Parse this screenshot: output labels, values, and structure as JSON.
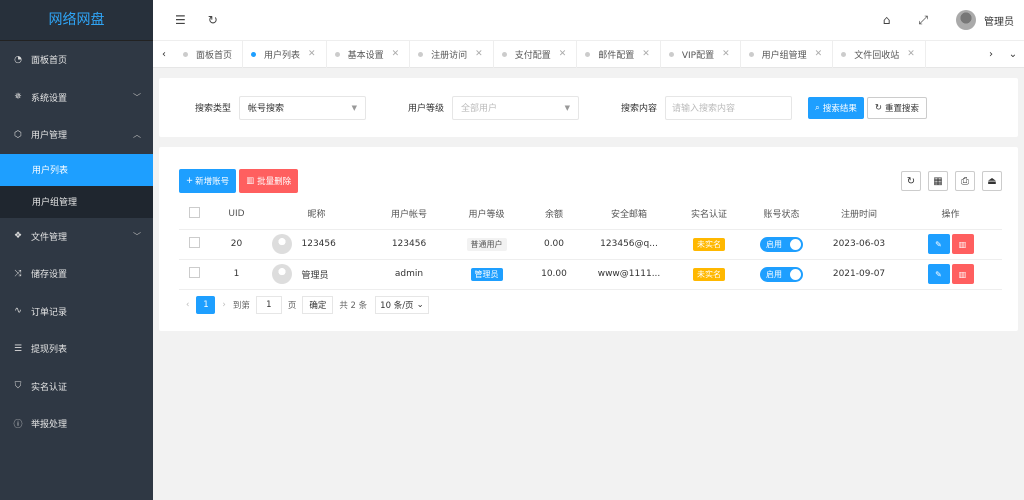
{
  "app": {
    "logo": "网络网盘"
  },
  "sidebar": {
    "items": [
      {
        "label": "面板首页",
        "icon": "dashboard-icon"
      },
      {
        "label": "系统设置",
        "icon": "gear-icon"
      },
      {
        "label": "用户管理",
        "icon": "cube-icon"
      },
      {
        "label": "文件管理",
        "icon": "layers-icon"
      },
      {
        "label": "储存设置",
        "icon": "shuffle-icon"
      },
      {
        "label": "订单记录",
        "icon": "pulse-icon"
      },
      {
        "label": "提现列表",
        "icon": "list-icon"
      },
      {
        "label": "实名认证",
        "icon": "shield-icon"
      },
      {
        "label": "举报处理",
        "icon": "alert-icon"
      }
    ],
    "sub_items": [
      {
        "label": "用户列表"
      },
      {
        "label": "用户组管理"
      }
    ]
  },
  "topbar": {
    "admin_name": "管理员"
  },
  "tabs": [
    {
      "label": "面板首页"
    },
    {
      "label": "用户列表"
    },
    {
      "label": "基本设置"
    },
    {
      "label": "注册访问"
    },
    {
      "label": "支付配置"
    },
    {
      "label": "邮件配置"
    },
    {
      "label": "VIP配置"
    },
    {
      "label": "用户组管理"
    },
    {
      "label": "文件回收站"
    }
  ],
  "search": {
    "type_label": "搜索类型",
    "type_value": "帐号搜索",
    "level_label": "用户等级",
    "level_value": "全部用户",
    "content_label": "搜索内容",
    "content_placeholder": "请输入搜索内容",
    "search_btn": "搜索结果",
    "reset_btn": "重置搜索"
  },
  "toolbar": {
    "add_btn": "新增账号",
    "delete_btn": "批量删除"
  },
  "table": {
    "headers": [
      "UID",
      "昵称",
      "用户帐号",
      "用户等级",
      "余额",
      "安全邮箱",
      "实名认证",
      "账号状态",
      "注册时间",
      "操作"
    ],
    "rows": [
      {
        "uid": "20",
        "nickname": "123456",
        "account": "123456",
        "level": "普通用户",
        "balance": "0.00",
        "email": "123456@q...",
        "realname": "未实名",
        "status": "启用",
        "reg_time": "2023-06-03"
      },
      {
        "uid": "1",
        "nickname": "管理员",
        "account": "admin",
        "level": "管理员",
        "balance": "10.00",
        "email": "www@1111...",
        "realname": "未实名",
        "status": "启用",
        "reg_time": "2021-09-07"
      }
    ]
  },
  "pager": {
    "current": "1",
    "goto_label": "到第",
    "goto_value": "1",
    "page_unit": "页",
    "confirm": "确定",
    "total": "共 2 条",
    "per_page": "10 条/页"
  }
}
